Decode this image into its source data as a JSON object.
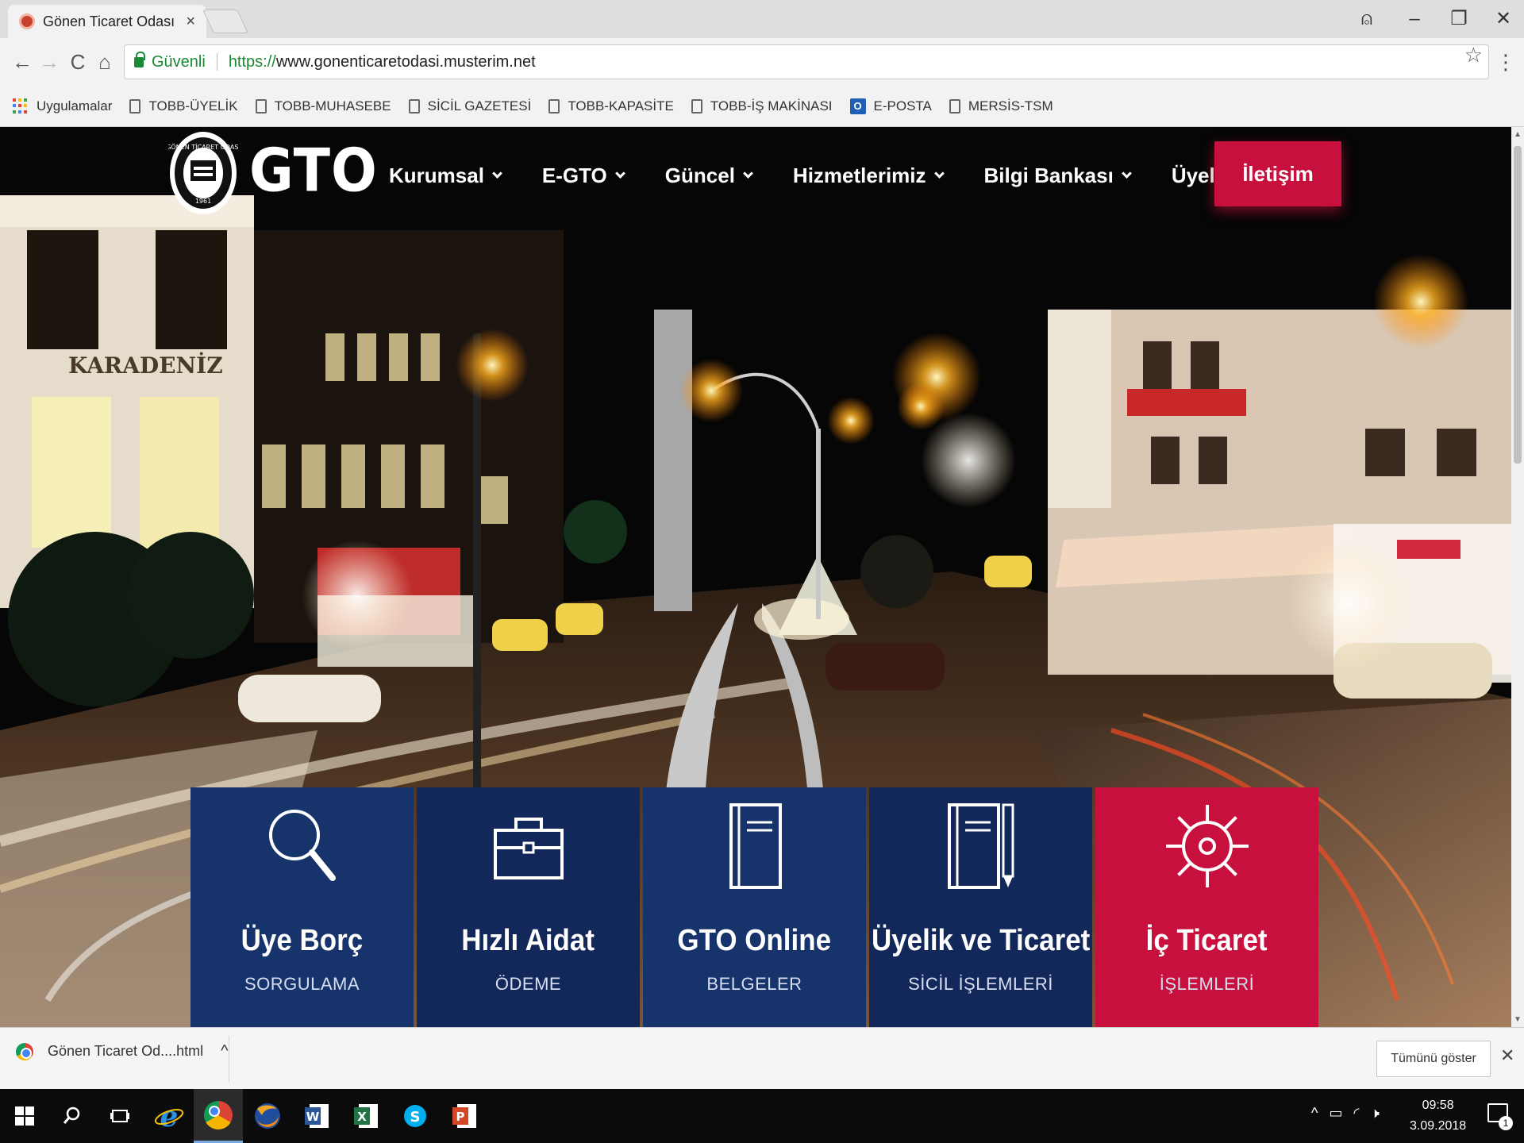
{
  "browser": {
    "tab_title": "Gönen Ticaret Odası",
    "tab_close": "×",
    "window_controls": {
      "account": "⍝",
      "minimize": "–",
      "restore": "❐",
      "close": "✕"
    },
    "nav": {
      "back": "←",
      "forward": "→",
      "reload": "C",
      "home": "⌂"
    },
    "security_label": "Güvenli",
    "url_scheme": "https://",
    "url_host": "www.gonenticaretodasi.musterim.net",
    "bookmark_star": "☆",
    "menu": "⋮",
    "bookmarks": [
      {
        "label": "Uygulamalar",
        "icon": "apps-grid-icon"
      },
      {
        "label": "TOBB-ÜYELİK",
        "icon": "page-icon"
      },
      {
        "label": "TOBB-MUHASEBE",
        "icon": "page-icon"
      },
      {
        "label": "SİCİL GAZETESİ",
        "icon": "page-icon"
      },
      {
        "label": "TOBB-KAPASİTE",
        "icon": "page-icon"
      },
      {
        "label": "TOBB-İŞ MAKİNASI",
        "icon": "page-icon"
      },
      {
        "label": "E-POSTA",
        "icon": "outlook-icon"
      },
      {
        "label": "MERSİS-TSM",
        "icon": "page-icon"
      }
    ]
  },
  "site": {
    "logo_text": "GTO",
    "seal_text": "GÖNEN TİCARET ODASI",
    "seal_year": "1961",
    "nav": [
      {
        "label": "Kurumsal"
      },
      {
        "label": "E-GTO"
      },
      {
        "label": "Güncel"
      },
      {
        "label": "Hizmetlerimiz"
      },
      {
        "label": "Bilgi Bankası"
      },
      {
        "label": "Üyelik"
      }
    ],
    "contact_label": "İletişim",
    "hero_sign": "KARADENİZ",
    "tiles": [
      {
        "title": "Üye Borç",
        "subtitle": "SORGULAMA",
        "icon": "magnifier-icon"
      },
      {
        "title": "Hızlı Aidat",
        "subtitle": "ÖDEME",
        "icon": "briefcase-icon"
      },
      {
        "title": "GTO Online",
        "subtitle": "BELGELER",
        "icon": "book-icon"
      },
      {
        "title": "Üyelik ve Ticaret",
        "subtitle": "SİCİL İŞLEMLERİ",
        "icon": "notebook-pen-icon"
      },
      {
        "title": "İç Ticaret",
        "subtitle": "İŞLEMLERİ",
        "icon": "gear-icon"
      }
    ]
  },
  "download_bar": {
    "file_name": "Gönen Ticaret Od....html",
    "expand": "^",
    "show_all": "Tümünü göster",
    "close": "✕"
  },
  "taskbar": {
    "time": "09:58",
    "date": "3.09.2018",
    "notification_count": "1",
    "tray": {
      "chevron": "^",
      "speaker": "🕨"
    }
  },
  "colors": {
    "navy_tile": "#17336b",
    "dark_tile": "#13285a",
    "accent_red": "#c8103e",
    "secure_green": "#1a8a36"
  }
}
